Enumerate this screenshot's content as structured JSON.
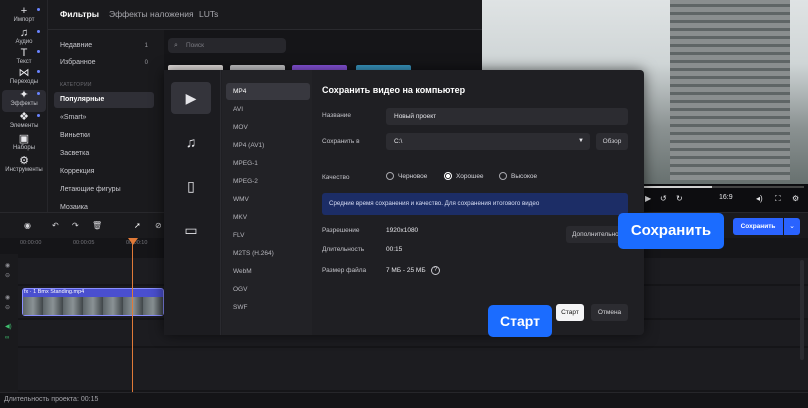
{
  "sidebar": {
    "tools": [
      {
        "label": "Импорт",
        "icon": "plus-icon"
      },
      {
        "label": "Аудио",
        "icon": "music-note-icon"
      },
      {
        "label": "Текст",
        "icon": "text-icon"
      },
      {
        "label": "Переходы",
        "icon": "transitions-icon"
      },
      {
        "label": "Эффекты",
        "icon": "sparkle-icon"
      },
      {
        "label": "Элементы",
        "icon": "elements-icon"
      },
      {
        "label": "Наборы",
        "icon": "box-icon"
      },
      {
        "label": "Инструменты",
        "icon": "tools-icon"
      }
    ]
  },
  "library": {
    "tabs": [
      "Фильтры",
      "Эффекты наложения",
      "LUTs"
    ],
    "search_placeholder": "Поиск",
    "top_items": [
      {
        "label": "Недавние",
        "count": "1"
      },
      {
        "label": "Избранное",
        "count": "0"
      }
    ],
    "categories_header": "КАТЕГОРИИ",
    "categories": [
      "Популярные",
      "«Smart»",
      "Виньетки",
      "Засветка",
      "Коррекция",
      "Летающие фигуры",
      "Мозаика"
    ]
  },
  "preview": {
    "aspect": "16:9"
  },
  "timeline": {
    "ticks": [
      "00:00:00",
      "00:00:05",
      "00:00:10"
    ],
    "clip_name": "fx · 1  Bmx Standing.mp4"
  },
  "status": {
    "project_length": "Длительность проекта: 00:15"
  },
  "dialog": {
    "formats": [
      "MP4",
      "AVI",
      "MOV",
      "MP4 (AV1)",
      "MPEG-1",
      "MPEG-2",
      "WMV",
      "MKV",
      "FLV",
      "M2TS (H.264)",
      "WebM",
      "OGV",
      "SWF"
    ],
    "title": "Сохранить видео на компьютер",
    "name_label": "Название",
    "name_value": "Новый проект",
    "save_to_label": "Сохранить в",
    "save_to_value": "C:\\",
    "browse_label": "Обзор",
    "quality_label": "Качество",
    "quality_options": [
      "Черновое",
      "Хорошее",
      "Высокое"
    ],
    "quality_selected": "Хорошее",
    "info_text": "Средние время сохранения и качество. Для сохранения итогового видео",
    "resolution_label": "Разрешение",
    "resolution_value": "1920x1080",
    "duration_label": "Длительность",
    "duration_value": "00:15",
    "filesize_label": "Размер файла",
    "filesize_value": "7 МБ - 25 МБ",
    "more_label": "Дополнительно",
    "start_label": "Старт",
    "cancel_label": "Отмена"
  },
  "toolbar": {
    "save_label": "Сохранить"
  },
  "callouts": {
    "save": "Сохранить",
    "start": "Старт"
  },
  "colors": {
    "accent": "#2a63ff",
    "callout": "#1b6cff",
    "playhead": "#e07a38",
    "clip": "#4a4fcf"
  }
}
